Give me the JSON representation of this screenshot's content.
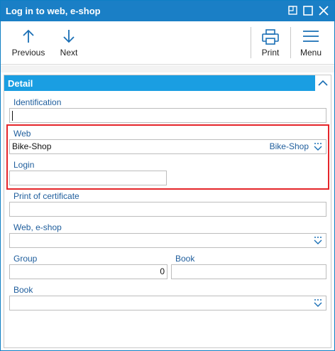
{
  "window": {
    "title": "Log in to web, e-shop"
  },
  "toolbar": {
    "previous_label": "Previous",
    "next_label": "Next",
    "print_label": "Print",
    "menu_label": "Menu"
  },
  "panel": {
    "title": "Detail"
  },
  "fields": {
    "identification": {
      "label": "Identification",
      "value": ""
    },
    "web": {
      "label": "Web",
      "value": "Bike-Shop",
      "link_value": "Bike-Shop"
    },
    "login": {
      "label": "Login",
      "value": ""
    },
    "print_certificate": {
      "label": "Print of certificate",
      "value": ""
    },
    "web_eshop": {
      "label": "Web, e-shop",
      "value": ""
    },
    "group": {
      "label": "Group",
      "value": "0"
    },
    "book_right": {
      "label": "Book",
      "value": ""
    },
    "book": {
      "label": "Book",
      "value": ""
    }
  },
  "colors": {
    "titlebar": "#1a7fc6",
    "panel_header": "#1a9ee2",
    "label": "#1e5d9c",
    "highlight": "#e5252a"
  },
  "icons": [
    "maximize-icon",
    "restore-icon",
    "close-icon",
    "arrow-up-icon",
    "arrow-down-icon",
    "printer-icon",
    "hamburger-menu-icon",
    "chevron-up-icon",
    "dropdown-icon"
  ]
}
